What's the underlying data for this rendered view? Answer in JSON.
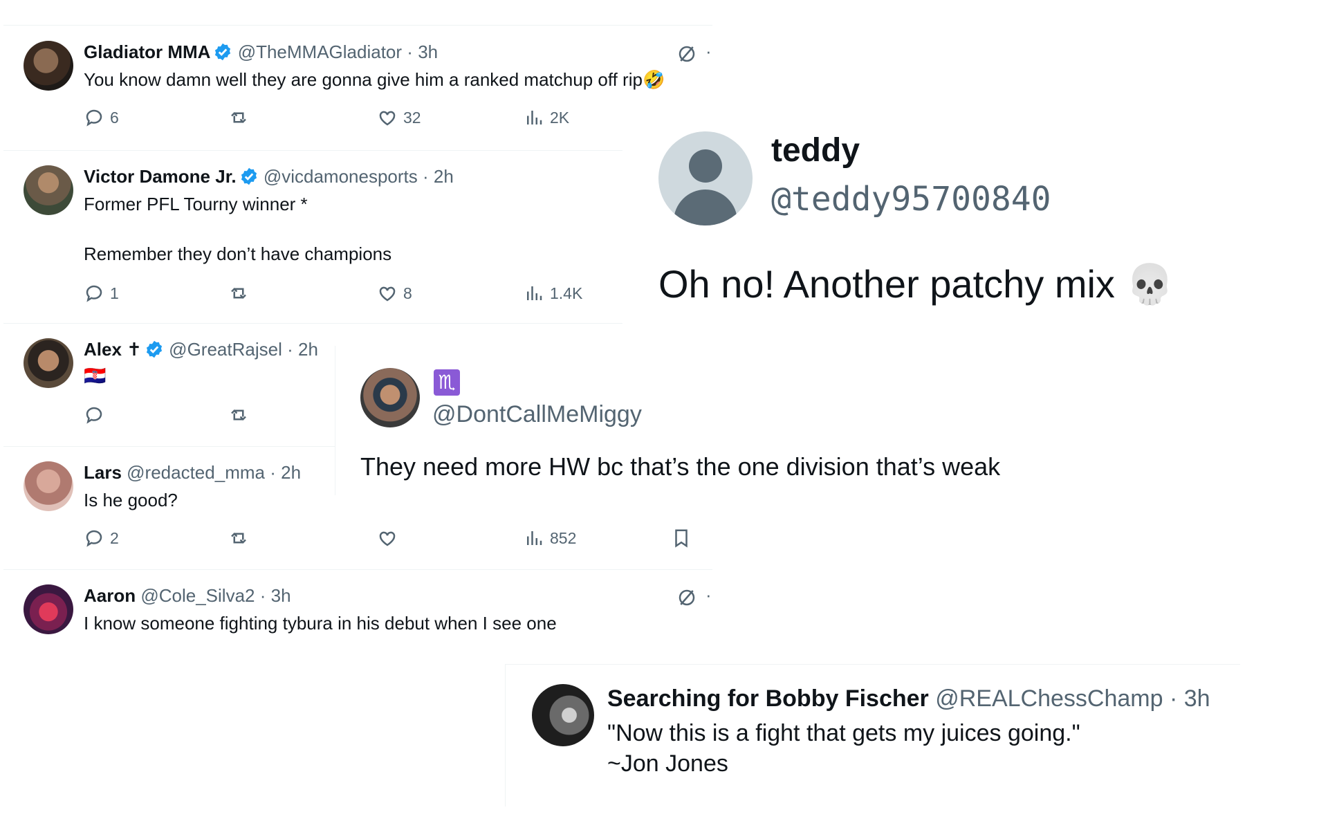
{
  "panel1": {
    "tweets": [
      {
        "name": "Gladiator MMA",
        "verified": true,
        "handle": "@TheMMAGladiator",
        "time": "3h",
        "text": "You know damn well they are gonna give him a ranked matchup off rip",
        "emoji": "🤣",
        "replies": "6",
        "likes": "32",
        "views": "2K"
      },
      {
        "name": "Victor Damone Jr.",
        "verified": true,
        "handle": "@vicdamonesports",
        "time": "2h",
        "text": "Former PFL Tourny winner *",
        "text2": "Remember they don’t have champions",
        "replies": "1",
        "likes": "8",
        "views": "1.4K"
      },
      {
        "name": "Alex ✝",
        "verified": true,
        "handle": "@GreatRajsel",
        "time": "2h",
        "flag": "🇭🇷"
      },
      {
        "name": "Lars",
        "handle": "@redacted_mma",
        "time": "2h",
        "text": "Is he good?",
        "replies": "2",
        "views": "852"
      },
      {
        "name": "Aaron",
        "handle": "@Cole_Silva2",
        "time": "3h",
        "text": "I know someone fighting tybura in his debut when I see one"
      }
    ]
  },
  "panel_teddy": {
    "name": "teddy",
    "handle": "@teddy95700840",
    "text": "Oh no! Another patchy mix",
    "emoji": "💀"
  },
  "panel_miggy": {
    "badge": "♏",
    "handle": "@DontCallMeMiggy",
    "text": "They need more HW bc that’s the one division that’s weak"
  },
  "panel_bobby": {
    "name": "Searching for Bobby Fischer",
    "handle": "@REALChessChamp",
    "time": "3h",
    "text": "\"Now this is a fight that gets my juices going.\"",
    "text2": "~Jon Jones"
  },
  "separator": "·",
  "colors": {
    "verified": "#1d9bf0",
    "secondary": "#536471",
    "border": "#eff3f4"
  }
}
